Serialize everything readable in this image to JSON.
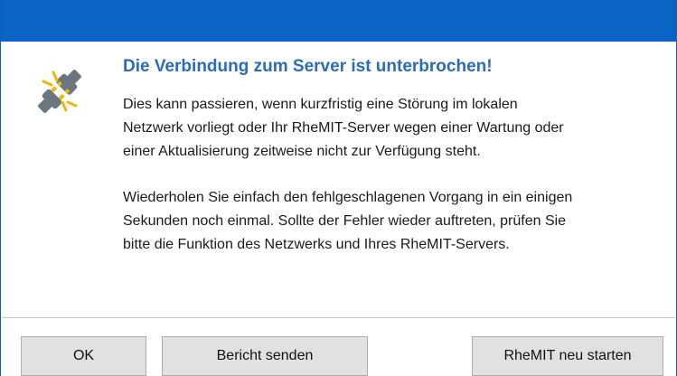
{
  "dialog": {
    "heading": "Die Verbindung zum Server ist unterbrochen!",
    "message_lines_1": [
      "Dies kann passieren, wenn kurzfristig eine Störung im lokalen",
      "Netzwerk vorliegt oder Ihr RheMIT-Server wegen einer Wartung oder",
      "einer Aktualisierung zeitweise nicht zur Verfügung steht."
    ],
    "message_lines_2": [
      "Wiederholen Sie einfach den fehlgeschlagenen Vorgang in ein einigen",
      "Sekunden noch einmal. Sollte der Fehler wieder auftreten, prüfen Sie",
      "bitte die Funktion des Netzwerks und Ihres RheMIT-Servers."
    ],
    "icon": "unplugged-connector-icon"
  },
  "buttons": {
    "ok": "OK",
    "report": "Bericht senden",
    "restart": "RheMIT neu starten"
  },
  "colors": {
    "titlebar": "#0b63c4",
    "heading": "#2b6cb8",
    "icon_gray": "#6b7780",
    "icon_yellow": "#f2b705"
  }
}
